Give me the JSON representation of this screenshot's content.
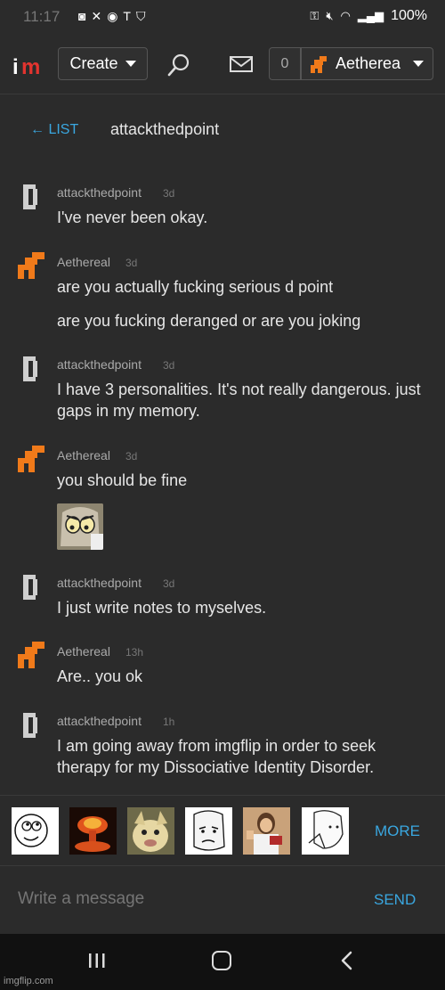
{
  "status_bar": {
    "time": "11:17",
    "battery": "100%"
  },
  "nav": {
    "logo_i": "i",
    "logo_m": "m",
    "create_label": "Create",
    "notification_count": "0",
    "username": "Aetherea"
  },
  "header": {
    "back_label": "← LIST",
    "conversation_title": "attackthedpoint"
  },
  "messages": [
    {
      "user": "attackthedpoint",
      "time": "3d",
      "lines": [
        "I've never been okay."
      ]
    },
    {
      "user": "Aethereal",
      "time": "3d",
      "lines": [
        "are you actually fucking serious d point",
        "are you fucking deranged or are you joking"
      ]
    },
    {
      "user": "attackthedpoint",
      "time": "3d",
      "lines": [
        "I have 3 personalities. It's not really dangerous. just gaps in my memory."
      ]
    },
    {
      "user": "Aethereal",
      "time": "3d",
      "lines": [
        "you should be fine"
      ]
    },
    {
      "user": "attackthedpoint",
      "time": "3d",
      "lines": [
        "I just write notes to myselves."
      ]
    },
    {
      "user": "Aethereal",
      "time": "13h",
      "lines": [
        "Are.. you ok"
      ]
    },
    {
      "user": "attackthedpoint",
      "time": "1h",
      "lines": [
        "I am going away from imgflip in order to seek therapy for my Dissociative Identity Disorder."
      ]
    }
  ],
  "meme_strip": {
    "more_label": "MORE"
  },
  "compose": {
    "placeholder": "Write a message",
    "send_label": "SEND"
  },
  "watermark": "imgflip.com",
  "colors": {
    "background": "#2b2b2b",
    "accent_link": "#3aa7e0",
    "logo_red": "#e3342f",
    "avatar_orange": "#f07a1a"
  }
}
